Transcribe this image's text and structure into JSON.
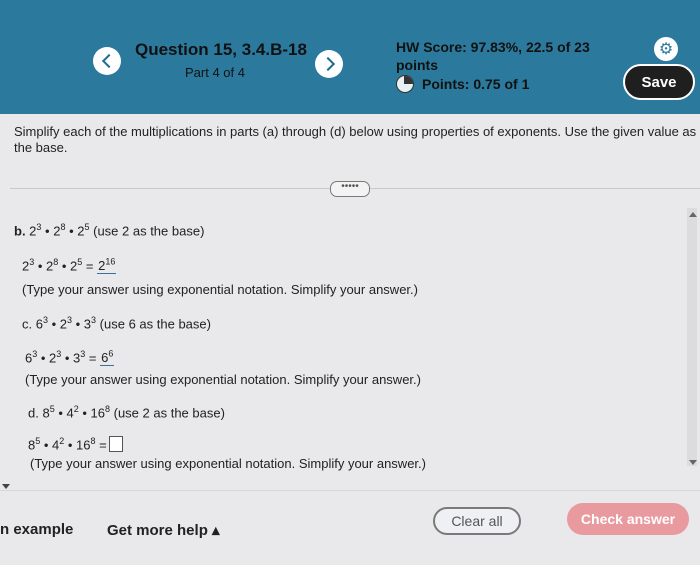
{
  "header": {
    "question_title": "Question 15, 3.4.B-18",
    "part_label": "Part 4 of 4",
    "hw_score": "HW Score: 97.83%, 22.5 of 23",
    "hw_points_word": "points",
    "points": "Points: 0.75 of 1",
    "save_label": "Save"
  },
  "instructions": "Simplify each of the multiplications in parts (a) through (d) below using properties of exponents. Use the given value as the base.",
  "more_label": "•••••",
  "parts": {
    "b": {
      "label": "b.",
      "base_note": "(use 2 as the base)",
      "answer_exp": "16",
      "hint": "(Type your answer using exponential notation. Simplify your answer.)"
    },
    "c": {
      "label": "c.",
      "base_note": "(use 6 as the base)",
      "answer_exp": "6",
      "hint": "(Type your answer using exponential notation. Simplify your answer.)"
    },
    "d": {
      "label": "d.",
      "base_note": "(use 2 as the base)",
      "hint": "(Type your answer using exponential notation. Simplify your answer.)"
    }
  },
  "footer": {
    "example": "n example",
    "more_help": "Get more help ▴",
    "clear_all": "Clear all",
    "check_answer": "Check answer"
  }
}
